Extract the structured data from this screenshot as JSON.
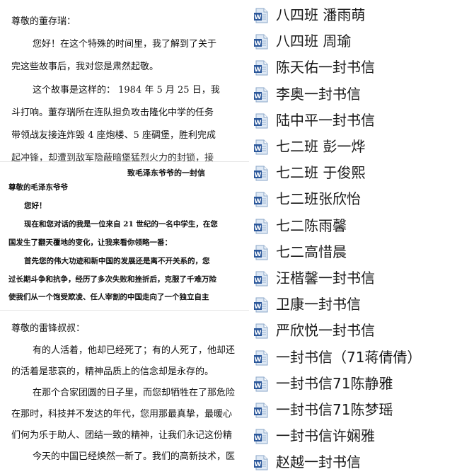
{
  "documents": [
    {
      "lines": [
        "尊敬的董存瑞：",
        "您好！在这个特殊的时间里，我了解到了关于",
        "完这些故事后，我对您是肃然起敬。",
        "这个故事是这样的：  1984 年 5 月 25 日，我",
        "斗打响。董存瑞所在连队担负攻击隆化中学的任务",
        "带领战友接连炸毁 4 座炮楼、5 座碉堡，胜利完成",
        "起冲锋，却遭到敌军隐蔽暗堡猛烈火力的封锁，接"
      ]
    },
    {
      "title": "致毛泽东爷爷的一封信",
      "lines": [
        "尊敬的毛泽东爷爷",
        "您好！",
        "现在和您对话的我是一位来自 21 世纪的一名中学生，在您",
        "国发生了翻天覆地的变化，让我来看你领略一番：",
        "首先您的伟大功迹和新中国的发展还是离不开关系的，您",
        "过长期斗争和抗争，经历了多次失败和挫折后，克服了千难万险",
        "使我们从一个饱受欺凌、任人宰割的中国走向了一个独立自主"
      ]
    },
    {
      "lines": [
        "尊敬的雷锋叔叔：",
        "有的人活着，他却已经死了；有的人死了，他却还",
        "的活着是悲哀的，精神品质上的信念却是永存的。",
        "在那个合家团圆的日子里，而您却牺牲在了那危险",
        "在那时，科技并不发达的年代，您用那最真挚，最暖心",
        "们何为乐于助人、团结一致的精神，让我们永记这份精",
        "今天的中国已经焕然一新了。我们的高新技术，医"
      ]
    }
  ],
  "files": [
    "八四班 潘雨萌",
    "八四班 周瑜",
    "陈天佑一封书信",
    "李奥一封书信",
    "陆中平一封书信",
    "七二班 彭一烨",
    "七二班 于俊熙",
    "七二班张欣怡",
    "七二陈雨馨",
    "七二高惜晨",
    "汪楷馨一封书信",
    "卫康一封书信",
    "严欣悦一封书信",
    "一封书信（71蒋倩倩）",
    "一封书信71陈静雅",
    "一封书信71陈梦瑶",
    "一封书信许娴雅",
    "赵越一封书信"
  ],
  "colors": {
    "icon_blue": "#2b579a",
    "icon_page": "#dfe9f5"
  },
  "icon_name": "word-document-icon"
}
